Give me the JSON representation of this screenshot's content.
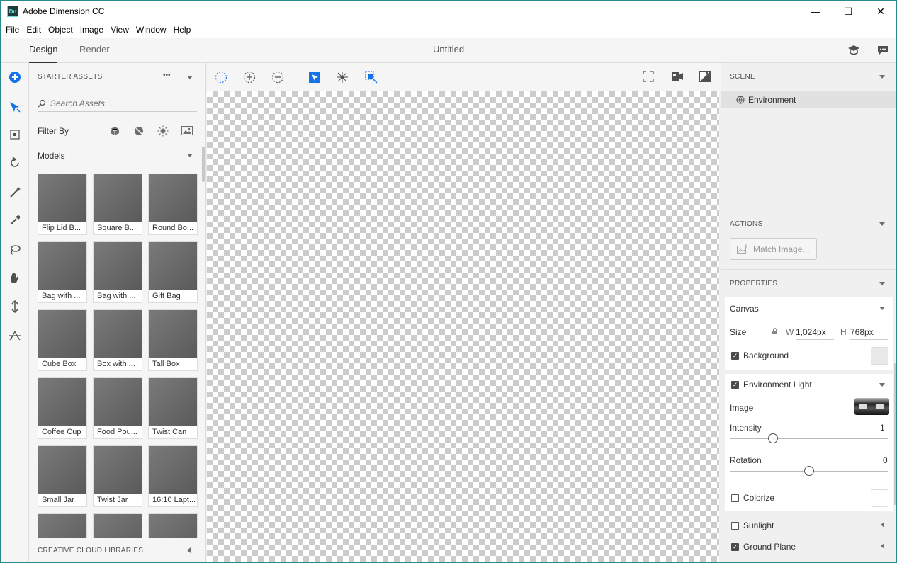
{
  "app": {
    "title": "Adobe Dimension CC",
    "logo_text": "Dn"
  },
  "window_controls": {
    "minimize": "—",
    "maximize": "☐",
    "close": "✕"
  },
  "menu": [
    "File",
    "Edit",
    "Object",
    "Image",
    "View",
    "Window",
    "Help"
  ],
  "tabs": {
    "design": "Design",
    "render": "Render"
  },
  "document": {
    "title": "Untitled"
  },
  "left_panel": {
    "header": "STARTER ASSETS",
    "more": "•••",
    "search_placeholder": "Search Assets...",
    "filter_label": "Filter By",
    "filters": [
      "models-filter-icon",
      "materials-filter-icon",
      "lights-filter-icon",
      "images-filter-icon"
    ],
    "category": "Models",
    "assets": [
      {
        "label": "Flip Lid B..."
      },
      {
        "label": "Square B..."
      },
      {
        "label": "Round Bo..."
      },
      {
        "label": "Bag with ..."
      },
      {
        "label": "Bag with ..."
      },
      {
        "label": "Gift Bag"
      },
      {
        "label": "Cube Box"
      },
      {
        "label": "Box with ..."
      },
      {
        "label": "Tall Box"
      },
      {
        "label": "Coffee Cup"
      },
      {
        "label": "Food Pou..."
      },
      {
        "label": "Twist Can"
      },
      {
        "label": "Small Jar"
      },
      {
        "label": "Twist Jar"
      },
      {
        "label": "16:10 Lapt..."
      },
      {
        "label": ""
      },
      {
        "label": ""
      },
      {
        "label": ""
      }
    ],
    "cc_libraries": "CREATIVE CLOUD LIBRARIES"
  },
  "tools": [
    "add-icon",
    "move-icon",
    "select-icon",
    "orbit-icon",
    "magic-wand-icon",
    "eyedropper-icon",
    "lasso-icon",
    "pan-icon",
    "dolly-icon",
    "horizon-icon"
  ],
  "canvas_toolbar": [
    "select-region-icon",
    "add-selection-icon",
    "subtract-selection-icon",
    "select-object-icon",
    "spread-icon",
    "frame-selection-icon",
    "fullscreen-icon",
    "camera-bookmark-icon",
    "render-preview-icon"
  ],
  "scene": {
    "header": "SCENE",
    "items": [
      {
        "label": "Environment"
      }
    ]
  },
  "actions": {
    "header": "ACTIONS",
    "match_image": "Match Image..."
  },
  "properties": {
    "header": "PROPERTIES",
    "canvas_label": "Canvas",
    "size_label": "Size",
    "w_label": "W",
    "w_value": "1,024px",
    "h_label": "H",
    "h_value": "768px",
    "background_label": "Background",
    "background_checked": true,
    "env_light_label": "Environment Light",
    "env_light_checked": true,
    "image_label": "Image",
    "intensity_label": "Intensity",
    "intensity_value": "1",
    "intensity_level": 0.27,
    "rotation_label": "Rotation",
    "rotation_value": "0",
    "rotation_level": 0.5,
    "colorize_label": "Colorize",
    "colorize_checked": false,
    "sunlight_label": "Sunlight",
    "sunlight_checked": false,
    "ground_plane_label": "Ground Plane",
    "ground_plane_checked": true
  },
  "colors": {
    "accent": "#1473e6",
    "app_logo_bg": "#1c3c3c",
    "app_logo_fg": "#5ee0d2"
  }
}
